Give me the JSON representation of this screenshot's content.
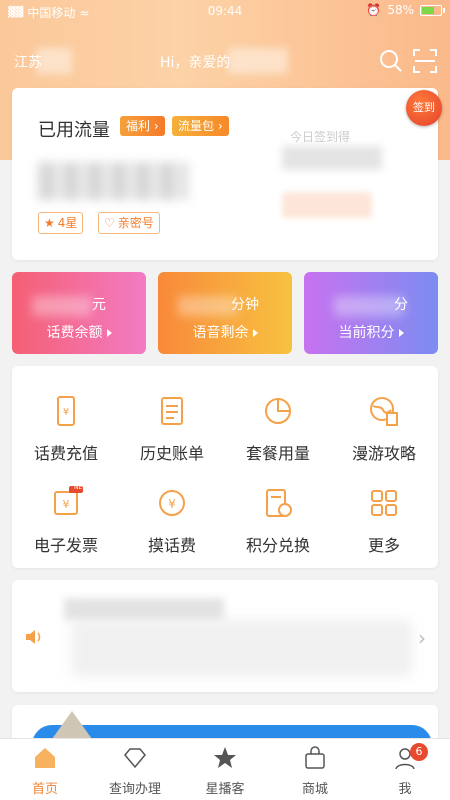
{
  "status_bar": {
    "carrier": "中国移动",
    "time": "09:44",
    "battery": "58%",
    "battery_level": 0.58
  },
  "header": {
    "city": "江苏",
    "greeting": "Hi，亲爱的"
  },
  "flow_card": {
    "title": "已用流量",
    "tag_fuli": "福利",
    "tag_liuliang": "流量包",
    "star_level": "4星",
    "intimacy": "亲密号",
    "sign_in": "签到",
    "today_sign": "今日签到得"
  },
  "stats": [
    {
      "value_suffix": "元",
      "label": "话费余额"
    },
    {
      "value_suffix": "分钟",
      "label": "语音剩余"
    },
    {
      "value_suffix": "分",
      "label": "当前积分"
    }
  ],
  "services": [
    {
      "label": "话费充值",
      "icon": "phone-yen-icon"
    },
    {
      "label": "历史账单",
      "icon": "bill-icon"
    },
    {
      "label": "套餐用量",
      "icon": "pie-chart-icon"
    },
    {
      "label": "漫游攻略",
      "icon": "globe-guide-icon"
    },
    {
      "label": "电子发票",
      "icon": "invoice-icon",
      "badge": "NEW"
    },
    {
      "label": "摸话费",
      "icon": "coin-yen-icon"
    },
    {
      "label": "积分兑换",
      "icon": "points-exchange-icon"
    },
    {
      "label": "更多",
      "icon": "more-grid-icon"
    }
  ],
  "tabs": [
    {
      "label": "首页",
      "icon": "home-icon"
    },
    {
      "label": "查询办理",
      "icon": "diamond-icon"
    },
    {
      "label": "星播客",
      "icon": "star-icon"
    },
    {
      "label": "商城",
      "icon": "bag-icon"
    },
    {
      "label": "我",
      "icon": "user-icon",
      "badge": "6"
    }
  ],
  "colors": {
    "accent": "#f0883a",
    "sign_in": "#e4402a",
    "badge": "#e74a2e"
  }
}
